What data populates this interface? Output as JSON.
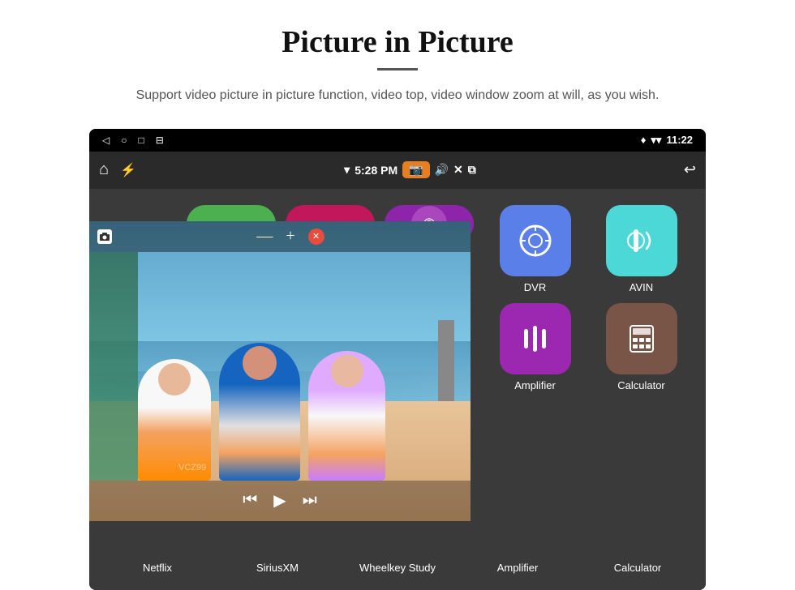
{
  "page": {
    "title": "Picture in Picture",
    "divider": "—",
    "subtitle": "Support video picture in picture function, video top, video window zoom at will, as you wish."
  },
  "status_bar": {
    "back_icon": "◁",
    "circle_icon": "○",
    "square_icon": "□",
    "menu_icon": "⊟",
    "location_icon": "♦",
    "wifi_icon": "▾",
    "time": "11:22"
  },
  "app_bar": {
    "home_icon": "⌂",
    "usb_icon": "⚡",
    "wifi_icon": "▾",
    "time": "5:28 PM",
    "camera_icon": "📷",
    "volume_icon": "🔊",
    "close_icon": "✕",
    "pip_icon": "⧉",
    "back_icon": "↩"
  },
  "pip": {
    "minus": "—",
    "plus": "+",
    "close": "✕",
    "prev": "⏮",
    "play": "▶",
    "next": "⏭"
  },
  "apps": {
    "top_row": [
      {
        "id": "netflix",
        "label": "Netflix",
        "color": "#4CAF50"
      },
      {
        "id": "siriusxm",
        "label": "SiriusXM",
        "color": "#E91E8C"
      },
      {
        "id": "wheelkey",
        "label": "Wheelkey Study",
        "color": "#9C27B0"
      }
    ],
    "right_grid": [
      {
        "id": "dvr",
        "label": "DVR",
        "color": "#5B7FE8"
      },
      {
        "id": "avin",
        "label": "AVIN",
        "color": "#4DD8D8"
      },
      {
        "id": "amplifier",
        "label": "Amplifier",
        "color": "#9C27B0"
      },
      {
        "id": "calculator",
        "label": "Calculator",
        "color": "#795548"
      }
    ]
  },
  "bottom_labels": {
    "items": [
      {
        "id": "netflix",
        "label": "Netflix"
      },
      {
        "id": "siriusxm",
        "label": "SiriusXM"
      },
      {
        "id": "wheelkey",
        "label": "Wheelkey Study"
      },
      {
        "id": "amplifier",
        "label": "Amplifier"
      },
      {
        "id": "calculator",
        "label": "Calculator"
      }
    ]
  },
  "watermark": "VCZ99"
}
